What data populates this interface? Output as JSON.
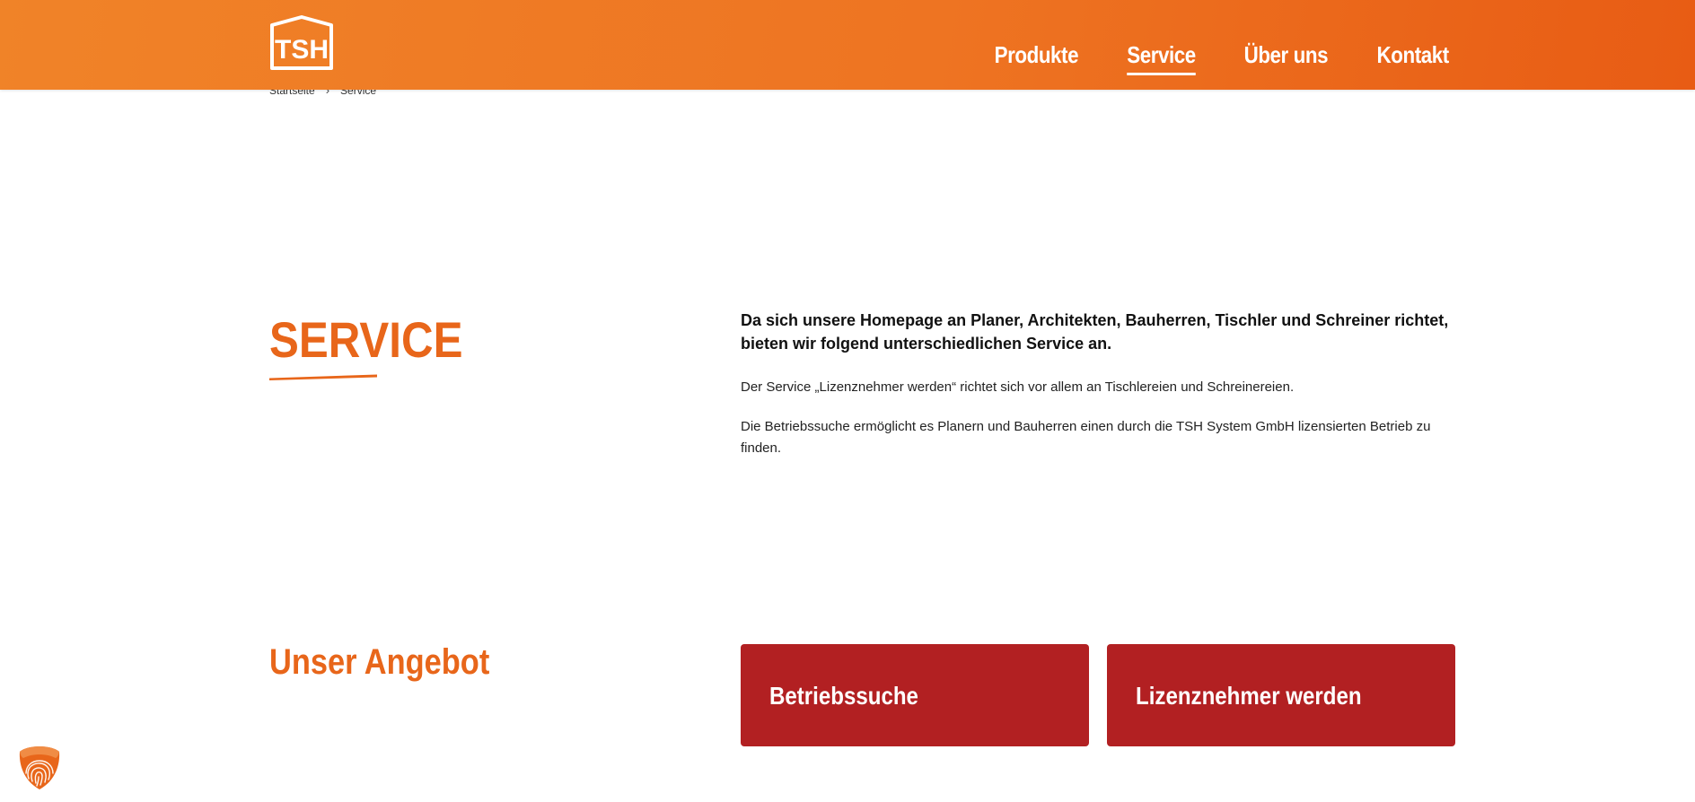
{
  "header": {
    "logo_text": "TSH",
    "nav": [
      {
        "label": "Produkte",
        "active": false
      },
      {
        "label": "Service",
        "active": true
      },
      {
        "label": "Über uns",
        "active": false
      },
      {
        "label": "Kontakt",
        "active": false
      }
    ]
  },
  "breadcrumb": {
    "home": "Startseite",
    "separator": "›",
    "current": "Service"
  },
  "main": {
    "title": "SERVICE",
    "lead": "Da sich unsere Homepage an Planer, Architekten, Bauherren, Tischler und Schreiner richtet, bieten wir folgend unterschiedlichen Service an.",
    "paragraphs": [
      "Der Service „Lizenznehmer werden“ richtet sich vor allem an Tischlereien und Schreinereien.",
      "Die Betriebssuche ermöglicht es Planern und Bauherren einen durch die TSH System GmbH lizensierten Betrieb zu finden."
    ]
  },
  "offer": {
    "title": "Unser Angebot",
    "cards": [
      {
        "label": "Betriebssuche"
      },
      {
        "label": "Lizenznehmer werden"
      }
    ]
  },
  "colors": {
    "brand_orange": "#ee7422",
    "title_orange": "#e8661a",
    "card_red": "#b22022"
  },
  "icons": {
    "privacy": "fingerprint-shield-icon"
  }
}
